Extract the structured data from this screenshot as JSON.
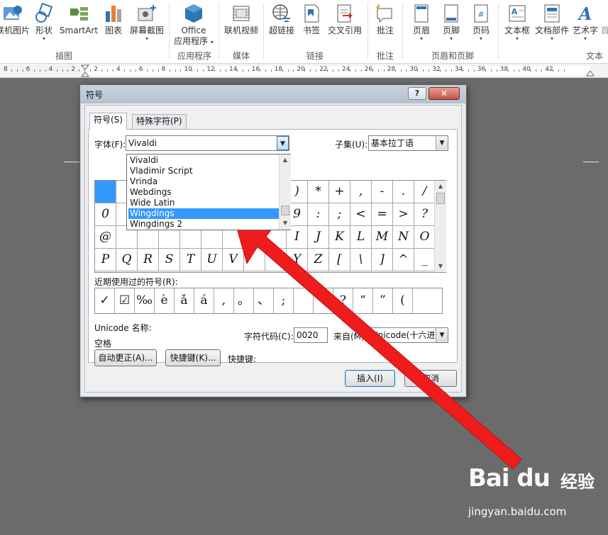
{
  "ribbon": {
    "buttons": [
      {
        "label": "联机图片",
        "caret": false
      },
      {
        "label": "形状",
        "caret": true
      },
      {
        "label": "SmartArt",
        "caret": false
      },
      {
        "label": "图表",
        "caret": false
      },
      {
        "label": "屏幕截图",
        "caret": true
      },
      {
        "label": "Office",
        "label2": "应用程序",
        "caret": true
      },
      {
        "label": "联机视频",
        "caret": false
      },
      {
        "label": "超链接",
        "caret": false
      },
      {
        "label": "书签",
        "caret": false
      },
      {
        "label": "交叉引用",
        "caret": false
      },
      {
        "label": "批注",
        "caret": false
      },
      {
        "label": "页眉",
        "caret": true
      },
      {
        "label": "页脚",
        "caret": true
      },
      {
        "label": "页码",
        "caret": true
      },
      {
        "label": "文本框",
        "caret": true
      },
      {
        "label": "文档部件",
        "caret": true
      },
      {
        "label": "艺术字",
        "caret": true
      },
      {
        "label": "首",
        "caret": false
      }
    ],
    "groups": [
      "插图",
      "应用程序",
      "媒体",
      "链接",
      "批注",
      "页眉和页脚",
      "文本"
    ]
  },
  "ruler": {
    "numbers": [
      "8",
      "6",
      "4",
      "2",
      "2",
      "4",
      "6",
      "8",
      "10",
      "12",
      "14",
      "16",
      "18",
      "20",
      "22",
      "24",
      "26",
      "28",
      "30",
      "32",
      "34",
      "36",
      "38",
      "40",
      "42"
    ]
  },
  "dialog": {
    "title": "符号",
    "help": "?",
    "close": "✕",
    "tabs": [
      "符号(S)",
      "特殊字符(P)"
    ],
    "font_label": "字体(F):",
    "font_value": "Vivaldi",
    "subset_label": "子集(U):",
    "subset_value": "基本拉丁语",
    "font_list": [
      "Vivaldi",
      "Vladimir Script",
      "Vrinda",
      "Webdings",
      "Wide Latin",
      "Wingdings",
      "Wingdings 2"
    ],
    "font_list_highlighted": "Wingdings",
    "grid_symbols": [
      [
        "",
        "",
        "",
        "",
        "",
        "",
        "",
        "",
        "",
        ")",
        "*",
        "+",
        ",",
        "-",
        ".",
        "/"
      ],
      [
        "0",
        "",
        "",
        "",
        "",
        "",
        "",
        "",
        "",
        "9",
        ":",
        ";",
        "<",
        "=",
        ">",
        "?"
      ],
      [
        "@",
        "",
        "",
        "",
        "",
        "",
        "",
        "",
        "",
        "I",
        "J",
        "K",
        "L",
        "M",
        "N",
        "O"
      ],
      [
        "P",
        "Q",
        "R",
        "S",
        "T",
        "U",
        "V",
        "",
        "",
        "Y",
        "Z",
        "[",
        "\\",
        "]",
        "^",
        "_"
      ]
    ],
    "recent_label": "近期使用过的符号(R):",
    "recent_symbols": [
      "✓",
      "☑",
      "‰",
      "è",
      "ǎ",
      "á",
      ",",
      "。",
      "、",
      ";",
      "",
      "!",
      "?",
      "“",
      "”",
      "("
    ],
    "unicode_name_label": "Unicode 名称:",
    "unicode_name_value": "空格",
    "char_code_label": "字符代码(C):",
    "char_code_value": "0020",
    "from_label": "来自(M):",
    "from_value": "Unicode(十六进制)",
    "autocorrect_button": "自动更正(A)...",
    "shortcut_button": "快捷键(K)...",
    "shortcut_label": "快捷键:",
    "insert_button": "插入(I)",
    "cancel_button": "取消"
  },
  "watermark": {
    "logo": "Bai du",
    "brand_cn": "经验",
    "url": "jingyan.baidu.com"
  },
  "colors": {
    "accent": "#3399ff",
    "arrow": "#ee1c1c"
  }
}
